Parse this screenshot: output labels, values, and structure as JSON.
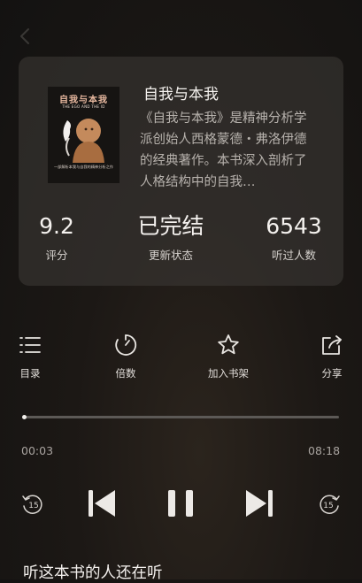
{
  "book": {
    "title": "自我与本我",
    "description": "《自我与本我》是精神分析学派创始人西格蒙德・弗洛伊德的经典著作。本书深入剖析了人格结构中的自我…",
    "cover": {
      "title": "自我与本我",
      "subtitle": "THE EGO AND THE ID",
      "tagline": "一部解析本我与自我的精神分析之作"
    }
  },
  "stats": [
    {
      "value": "9.2",
      "label": "评分"
    },
    {
      "value": "已完结",
      "label": "更新状态"
    },
    {
      "value": "6543",
      "label": "听过人数"
    }
  ],
  "toolbar": [
    {
      "icon": "list-icon",
      "label": "目录"
    },
    {
      "icon": "speed-icon",
      "label": "倍数"
    },
    {
      "icon": "star-icon",
      "label": "加入书架"
    },
    {
      "icon": "share-icon",
      "label": "分享"
    }
  ],
  "player": {
    "current_time": "00:03",
    "total_time": "08:18",
    "progress": 0.006,
    "rewind_seconds": "15",
    "forward_seconds": "15"
  },
  "section": {
    "title": "听这本书的人还在听"
  }
}
